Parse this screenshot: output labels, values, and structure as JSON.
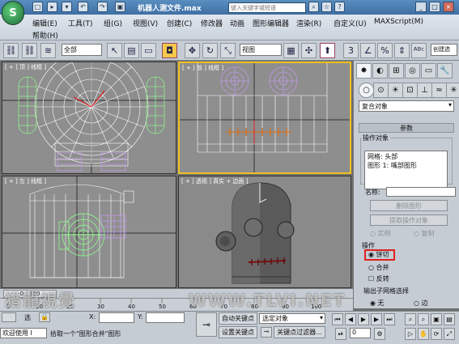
{
  "window": {
    "title": "机器人测文件.max",
    "search_placeholder": "键入关键字或短语",
    "logo_glyph": "S",
    "quick_icons": [
      "□",
      "▸",
      "▾",
      "↶",
      "↷",
      "▣"
    ]
  },
  "menu": {
    "row1": [
      "编辑(E)",
      "工具(T)",
      "组(G)",
      "视图(V)",
      "创建(C)",
      "修改器",
      "动画",
      "图形编辑器",
      "渲染(R)",
      "自定义(U)",
      "MAXScript(M)"
    ],
    "row2": [
      "帮助(H)"
    ]
  },
  "toolbar": {
    "filter_select": "全部",
    "coord_select": "视图",
    "create_selection_label": "创建选"
  },
  "viewports": {
    "top": "[ + ] 顶 ] 线框 ]",
    "front": "[ + ] 前 ] 线框 ]",
    "left": "[ + ] 左 ] 线框 ]",
    "perspective": "[ + ] 透视 ] 真实 + 边面 ]"
  },
  "command_panel": {
    "object_type_select": "复合对象",
    "rollout_title": "参数",
    "operands_title": "操作对象",
    "operand_list": [
      "网格: 头部",
      "图形 1: 嘴部图形"
    ],
    "name_label": "名称:",
    "delete_shape_button": "删除图形",
    "extract_operand_button": "提取操作对象",
    "instance_label": "实例",
    "copy_label": "复制",
    "operation_title": "操作",
    "op_cookie_label": "饼切",
    "op_merge_label": "合并",
    "invert_label": "反转",
    "output_title": "输出子网格选择",
    "none_label": "无",
    "edge_label": "边"
  },
  "timeline": {
    "frame_counter": "0 / 100",
    "ticks": [
      "0",
      "10",
      "20",
      "30",
      "40",
      "50",
      "60",
      "70",
      "80",
      "90",
      "100"
    ]
  },
  "status": {
    "welcome": "欢迎使用 I",
    "prompt": "拾取一个\"图形合并\"图形",
    "select_label": "选",
    "x_label": "X:",
    "y_label": "Y:",
    "auto_key_button": "自动关键点",
    "set_key_button": "设置关键点",
    "selected_object_select": "选定对象",
    "key_filters_button": "关键点过滤器...",
    "frame_field": "0"
  },
  "watermark": {
    "left": "猎龍視覺",
    "right": "WWW.TLVI.NET"
  },
  "colors": {
    "active_border": "#f0c020",
    "wire_green": "#8ef08e",
    "wire_purple": "#c09ae6",
    "highlight_red": "#e02020"
  }
}
